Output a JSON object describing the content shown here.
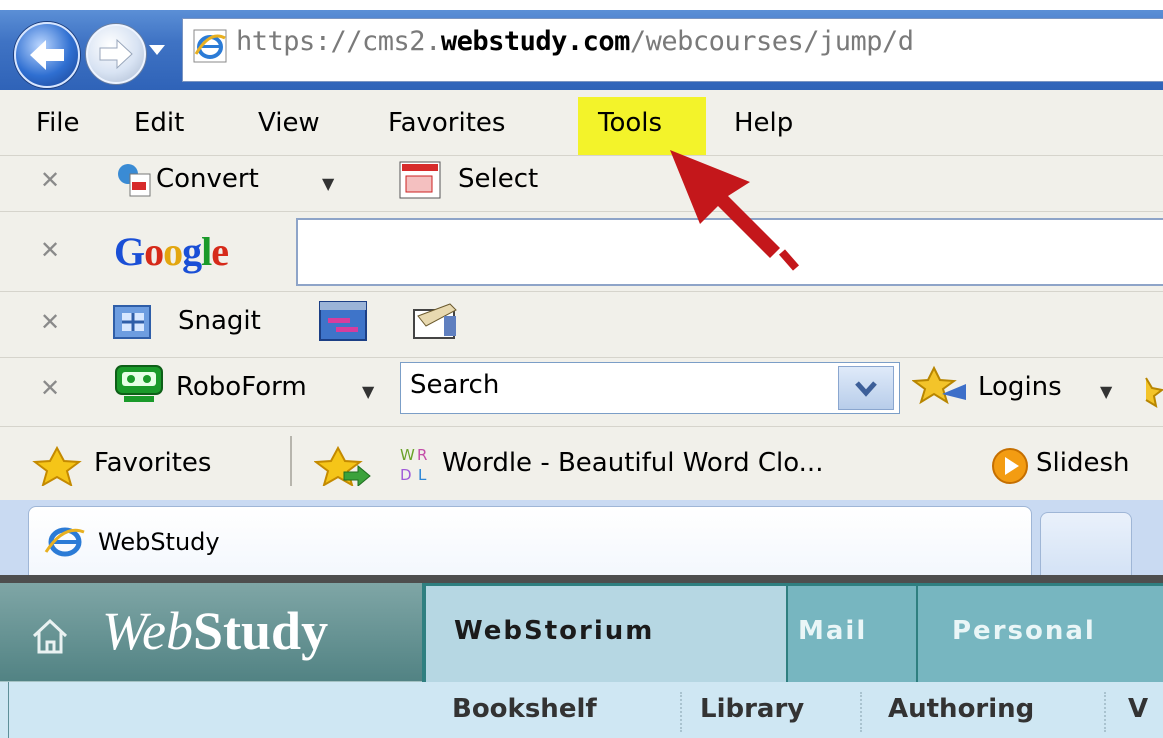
{
  "browser": {
    "address_url_prefix": "https://cms2.",
    "address_url_domain": "webstudy.com",
    "address_url_path": "/webcourses/jump/d"
  },
  "menubar": {
    "items": [
      "File",
      "Edit",
      "View",
      "Favorites",
      "Tools",
      "Help"
    ]
  },
  "toolbars": {
    "convert_label": "Convert",
    "select_label": "Select",
    "google_logo": "Google",
    "snagit_label": "Snagit",
    "roboform_label": "RoboForm",
    "roboform_search_value": "Search",
    "logins_label": "Logins"
  },
  "favorites_bar": {
    "favorites_label": "Favorites",
    "link1": "Wordle - Beautiful Word Clo...",
    "link2": "Slidesh"
  },
  "tabs": {
    "active_tab_title": "WebStudy"
  },
  "webstudy": {
    "logo_italic": "Web",
    "logo_bold": "Study",
    "nav_tabs": [
      "WebStorium",
      "Mail",
      "Personal"
    ],
    "sub_nav": [
      "Bookshelf",
      "Library",
      "Authoring",
      "V"
    ]
  },
  "colors": {
    "highlight": "#f3f32a",
    "arrow": "#c4171b",
    "webstudy_teal": "#2f7f80"
  },
  "icons": [
    "back-arrow-icon",
    "forward-arrow-icon",
    "history-dropdown-icon",
    "ie-page-icon",
    "convert-pdf-icon",
    "select-pdf-icon",
    "snagit-icon",
    "snagit-capture-icon",
    "snagit-editor-icon",
    "roboform-icon",
    "logins-icon",
    "favorites-star-icon",
    "add-favorites-icon",
    "wordle-icon",
    "slideshare-icon",
    "home-icon",
    "annotation-arrow-icon"
  ]
}
